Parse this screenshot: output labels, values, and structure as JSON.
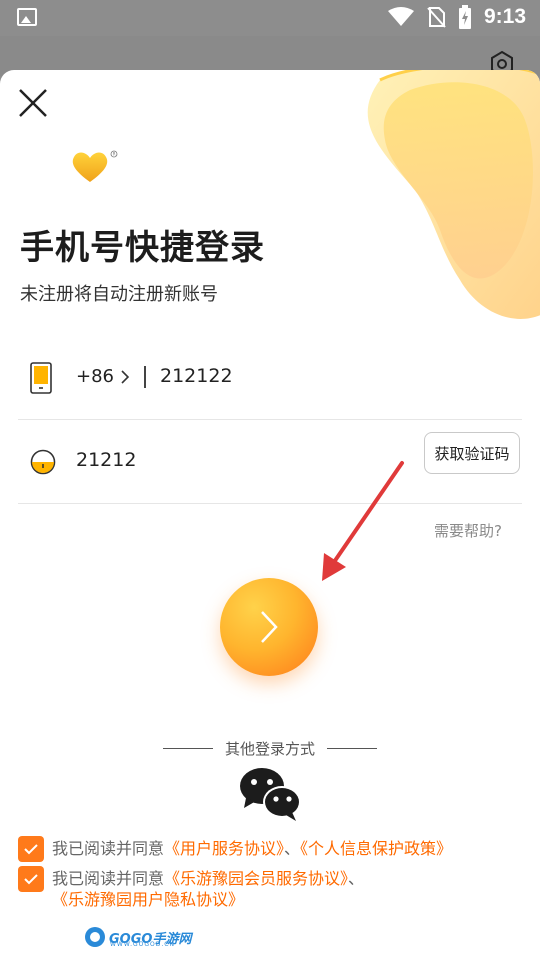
{
  "status_bar": {
    "time": "9:13"
  },
  "login": {
    "title": "手机号快捷登录",
    "subtitle": "未注册将自动注册新账号",
    "country_code": "+86",
    "phone_value": "212122",
    "code_value": "21212",
    "get_code_label": "获取验证码",
    "help_label": "需要帮助?",
    "other_methods_label": "其他登录方式"
  },
  "agreements": {
    "line1_prefix": "我已阅读并同意",
    "line1_link1": "《用户服务协议》",
    "sep": "、",
    "line1_link2": "《个人信息保护政策》",
    "line2_prefix": "我已阅读并同意",
    "line2_link1": "《乐游豫园会员服务协议》",
    "line2_link2": "《乐游豫园用户隐私协议》"
  },
  "watermark": {
    "text": "GOGO手游网",
    "sub": "WWW.GOGOD.CN"
  },
  "colors": {
    "accent": "#ff7a1a",
    "link": "#ff6a00",
    "help": "#8a8a8a"
  }
}
